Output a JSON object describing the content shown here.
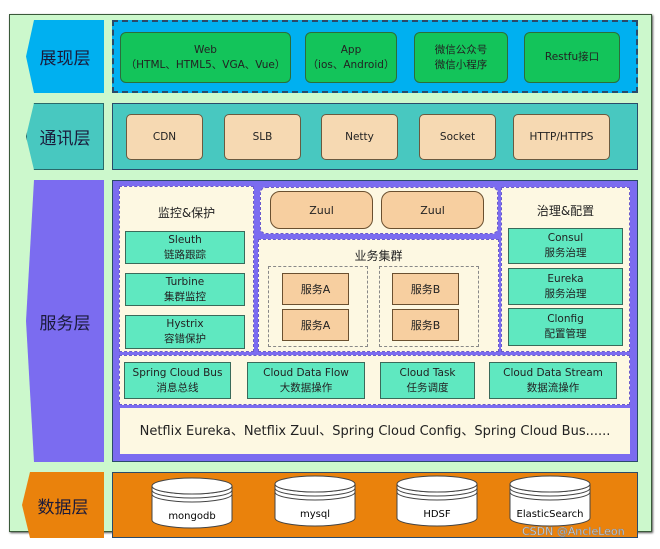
{
  "layers": {
    "presentation": {
      "label": "展现层",
      "items": [
        {
          "line1": "Web",
          "line2": "（HTML、HTML5、VGA、Vue）"
        },
        {
          "line1": "App",
          "line2": "（ios、Android）"
        },
        {
          "line1": "微信公众号",
          "line2": "微信小程序"
        },
        {
          "line1": "Restfu接口",
          "line2": ""
        }
      ]
    },
    "communication": {
      "label": "通讯层",
      "items": [
        "CDN",
        "SLB",
        "Netty",
        "Socket",
        "HTTP/HTTPS"
      ]
    },
    "service": {
      "label": "服务层",
      "monitoring": {
        "title": "监控&保护",
        "items": [
          {
            "line1": "Sleuth",
            "line2": "链路跟踪"
          },
          {
            "line1": "Turbine",
            "line2": "集群监控"
          },
          {
            "line1": "Hystrix",
            "line2": "容错保护"
          }
        ]
      },
      "gateway": [
        "Zuul",
        "Zuul"
      ],
      "cluster": {
        "title": "业务集群",
        "services": [
          "服务A",
          "服务A",
          "服务B",
          "服务B"
        ]
      },
      "governance": {
        "title": "治理&配置",
        "items": [
          {
            "line1": "Consul",
            "line2": "服务治理"
          },
          {
            "line1": "Eureka",
            "line2": "服务治理"
          },
          {
            "line1": "Clonfig",
            "line2": "配置管理"
          }
        ]
      },
      "bus_row": [
        {
          "line1": "Spring Cloud Bus",
          "line2": "消息总线"
        },
        {
          "line1": "Cloud Data Flow",
          "line2": "大数据操作"
        },
        {
          "line1": "Cloud Task",
          "line2": "任务调度"
        },
        {
          "line1": "Cloud Data Stream",
          "line2": "数据流操作"
        }
      ],
      "foundation": "Netflix Eureka、Netflix Zuul、Spring Cloud Config、Spring Cloud Bus......"
    },
    "data": {
      "label": "数据层",
      "items": [
        "mongodb",
        "mysql",
        "HDSF",
        "ElasticSearch"
      ]
    }
  },
  "watermark": "CSDN @AncleLeon",
  "colors": {
    "presentation": "#00b0f0",
    "communication": "#48c8c0",
    "service": "#7b6cf0",
    "data": "#ea820c",
    "background": "#ccf8cc"
  }
}
